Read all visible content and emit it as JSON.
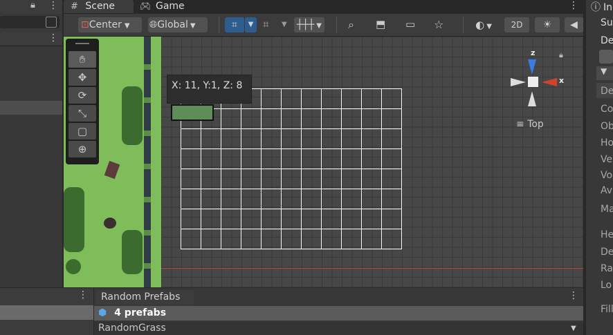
{
  "tabs": {
    "scene": "Scene",
    "game": "Game",
    "inspector_prefix": "In"
  },
  "toolbar": {
    "pivot": "Center",
    "space": "Global",
    "mode_2d": "2D"
  },
  "gizmo": {
    "z_label": "z",
    "x_label": "x",
    "view_label": "Top"
  },
  "tooltip": {
    "coords": "X: 11, Y:1, Z: 8"
  },
  "inspector": {
    "rows": [
      "Su",
      "De",
      "De",
      "Co",
      "Ob",
      "Ho",
      "Ve",
      "Vo",
      "Av",
      "Ma",
      "He",
      "De",
      "Ra",
      "Lo",
      "Fill"
    ]
  },
  "bottom": {
    "tab": "Random Prefabs",
    "prefab_count": "4 prefabs",
    "selection": "RandomGrass"
  },
  "colors": {
    "accent": "#3a79bb",
    "x_axis": "#d1432b",
    "z_axis": "#3a7de0"
  }
}
